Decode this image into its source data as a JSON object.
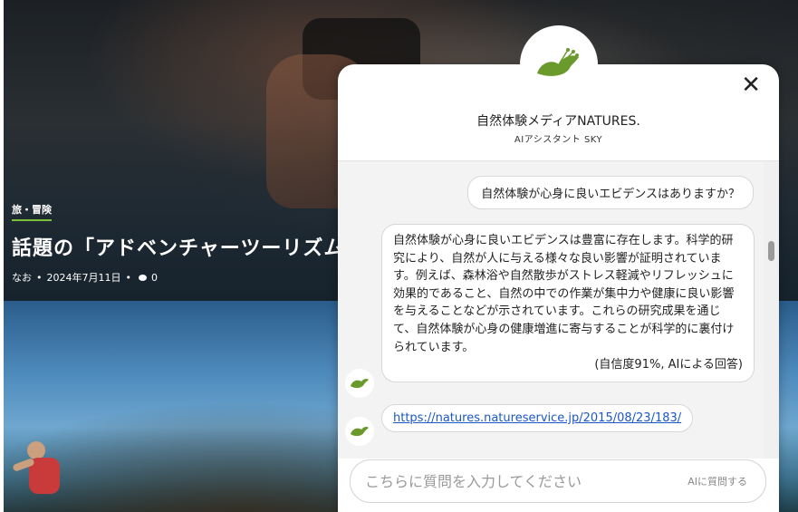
{
  "article": {
    "category": "旅・冒険",
    "title": "話題の「アドベンチャーツーリズム」",
    "author": "なお",
    "date": "2024年7月11日",
    "comments": "0"
  },
  "chat": {
    "brand": "自然体験メディアNATURES.",
    "assistant": "AIアシスタント SKY",
    "close_label": "✕",
    "user_message": "自然体験が心身に良いエビデンスはありますか？",
    "bot_message": "自然体験が心身に良いエビデンスは豊富に存在します。科学的研究により、自然が人に与える様々な良い影響が証明されています。例えば、森林浴や自然散歩がストレス軽減やリフレッシュに効果的であること、自然の中での作業が集中力や健康に良い影響を与えることなどが示されています。これらの研究成果を通じて、自然体験が心身の健康増進に寄与することが科学的に裏付けられています。",
    "confidence": "(自信度91%, AIによる回答)",
    "link": "https://natures.natureservice.jp/2015/08/23/183/",
    "input_placeholder": "こちらに質問を入力してください",
    "ask_button": "AIに質問する",
    "accent_color": "#6a9a2c"
  }
}
